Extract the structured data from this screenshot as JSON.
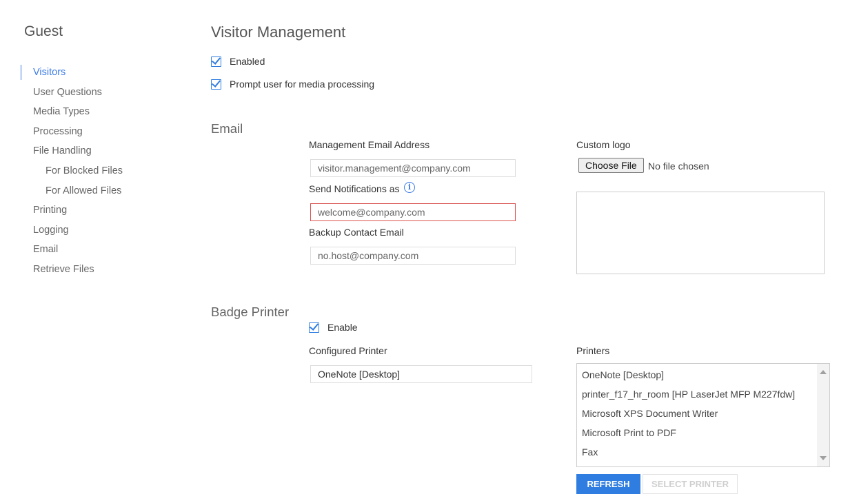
{
  "sidebar": {
    "title": "Guest",
    "items": [
      {
        "label": "Visitors"
      },
      {
        "label": "User Questions"
      },
      {
        "label": "Media Types"
      },
      {
        "label": "Processing"
      },
      {
        "label": "File Handling"
      },
      {
        "label": "For Blocked Files"
      },
      {
        "label": "For Allowed Files"
      },
      {
        "label": "Printing"
      },
      {
        "label": "Logging"
      },
      {
        "label": "Email"
      },
      {
        "label": "Retrieve Files"
      }
    ],
    "active": "Visitors"
  },
  "main": {
    "title": "Visitor Management",
    "enabled": {
      "label": "Enabled",
      "checked": true
    },
    "prompt_media": {
      "label": "Prompt user for media processing",
      "checked": true
    }
  },
  "email": {
    "section_title": "Email",
    "management": {
      "label": "Management Email Address",
      "value": "visitor.management@company.com"
    },
    "notifications": {
      "label": "Send Notifications as",
      "value": "welcome@company.com",
      "info_icon": "info-icon"
    },
    "backup": {
      "label": "Backup Contact Email",
      "value": "no.host@company.com"
    },
    "custom_logo": {
      "label": "Custom logo",
      "button": "Choose File",
      "status": "No file chosen"
    }
  },
  "badge_printer": {
    "section_title": "Badge Printer",
    "enable": {
      "label": "Enable",
      "checked": true
    },
    "configured": {
      "label": "Configured Printer",
      "value": "OneNote [Desktop]"
    },
    "printers": {
      "label": "Printers",
      "items": [
        "OneNote [Desktop]",
        "printer_f17_hr_room [HP LaserJet MFP M227fdw]",
        "Microsoft XPS Document Writer",
        "Microsoft Print to PDF",
        "Fax"
      ]
    },
    "refresh_button": "REFRESH",
    "select_button": "SELECT PRINTER"
  },
  "colors": {
    "accent": "#2f7de1",
    "error": "#d9534f"
  }
}
